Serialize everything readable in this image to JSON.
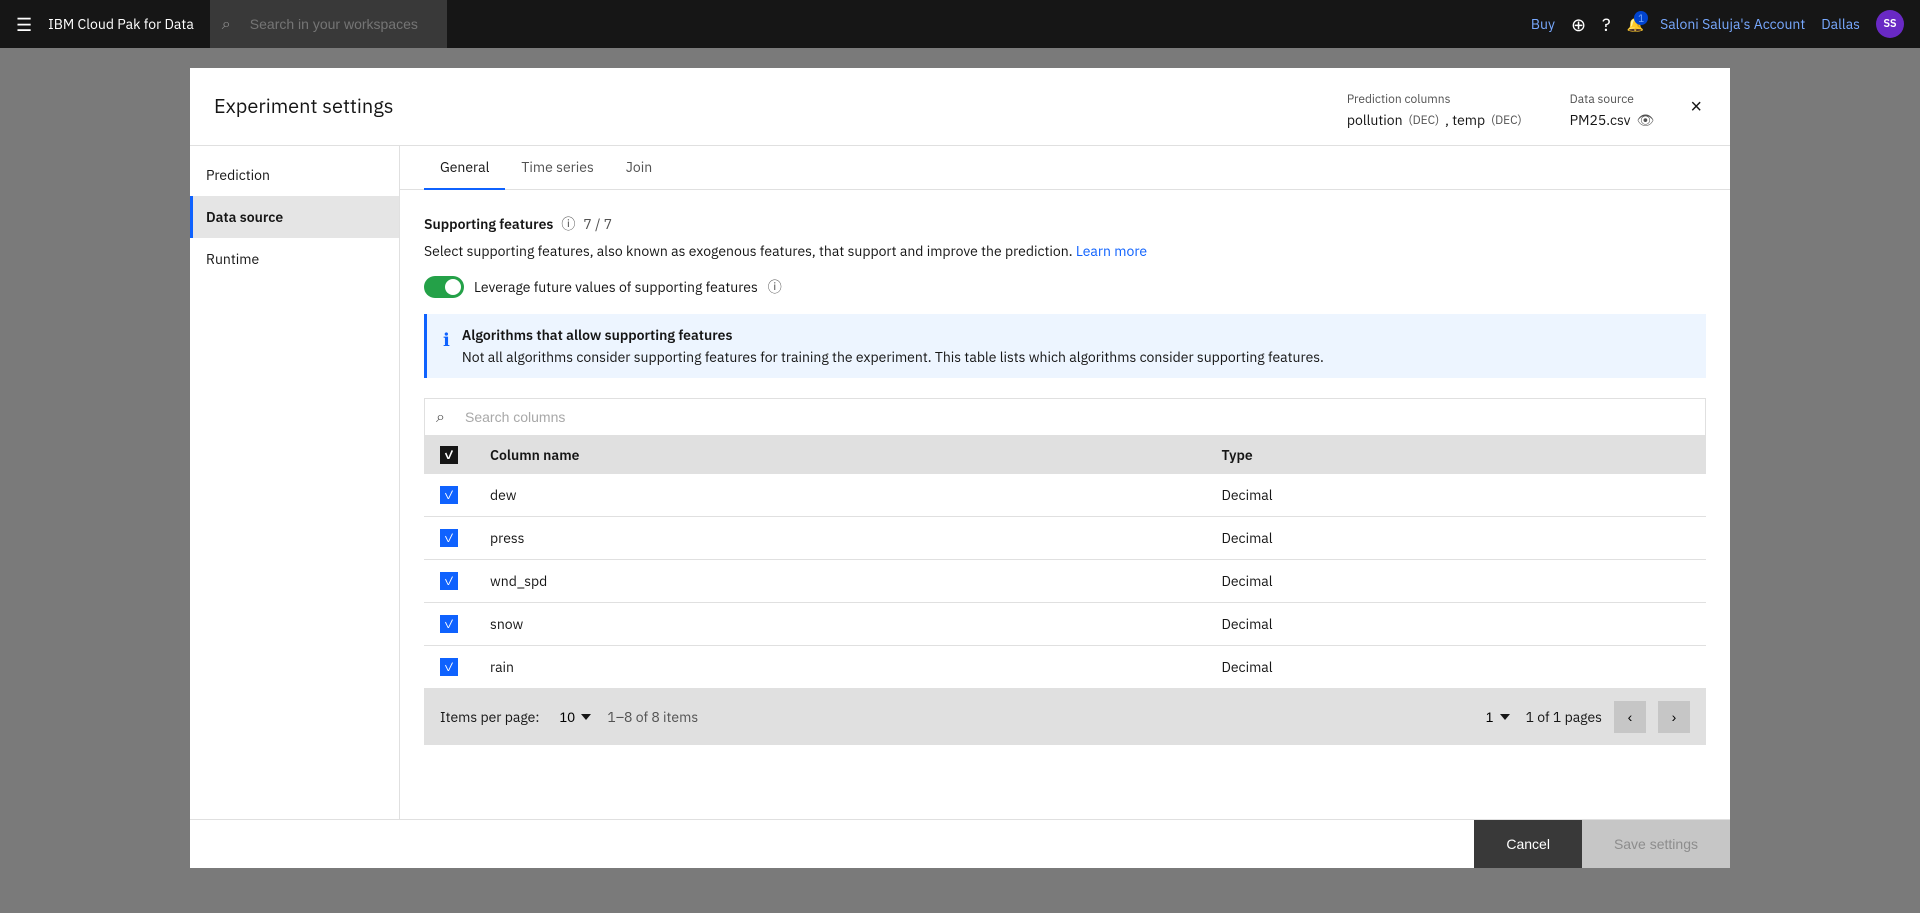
{
  "app": {
    "name": "IBM Cloud Pak for Data"
  },
  "topnav": {
    "search_placeholder": "Search in your workspaces",
    "buy_label": "Buy",
    "notification_count": "1",
    "user_name": "Saloni Saluja's Account",
    "region": "Dallas",
    "avatar_initials": "SS"
  },
  "modal": {
    "title": "Experiment settings",
    "close_label": "×",
    "prediction_columns_label": "Prediction columns",
    "prediction_columns_value": "pollution (DEC), temp (DEC)",
    "prediction_columns_plain": "pollution ",
    "prediction_columns_dec1": "(DEC)",
    "prediction_columns_sep": ", temp ",
    "prediction_columns_dec2": "(DEC)",
    "data_source_label": "Data source",
    "data_source_value": "PM25.csv"
  },
  "sidebar": {
    "items": [
      {
        "id": "prediction",
        "label": "Prediction",
        "active": false
      },
      {
        "id": "data-source",
        "label": "Data source",
        "active": true
      },
      {
        "id": "runtime",
        "label": "Runtime",
        "active": false
      }
    ]
  },
  "tabs": [
    {
      "id": "general",
      "label": "General",
      "active": true
    },
    {
      "id": "time-series",
      "label": "Time series",
      "active": false
    },
    {
      "id": "join",
      "label": "Join",
      "active": false
    }
  ],
  "supporting_features": {
    "title": "Supporting features",
    "count": "7 / 7",
    "description": "Select supporting features, also known as exogenous features, that support and improve the prediction.",
    "learn_more": "Learn more",
    "toggle_label": "Leverage future values of supporting features",
    "info_icon": "ⓘ"
  },
  "info_box": {
    "title": "Algorithms that allow supporting features",
    "description": "Not all algorithms consider supporting features for training the experiment. This table lists which algorithms consider supporting features."
  },
  "search": {
    "placeholder": "Search columns"
  },
  "table": {
    "headers": [
      {
        "id": "select",
        "label": ""
      },
      {
        "id": "column-name",
        "label": "Column name"
      },
      {
        "id": "type",
        "label": "Type"
      }
    ],
    "rows": [
      {
        "id": 1,
        "column_name": "dew",
        "type": "Decimal",
        "checked": true
      },
      {
        "id": 2,
        "column_name": "press",
        "type": "Decimal",
        "checked": true
      },
      {
        "id": 3,
        "column_name": "wnd_spd",
        "type": "Decimal",
        "checked": true
      },
      {
        "id": 4,
        "column_name": "snow",
        "type": "Decimal",
        "checked": true
      },
      {
        "id": 5,
        "column_name": "rain",
        "type": "Decimal",
        "checked": true
      }
    ]
  },
  "pagination": {
    "items_per_page_label": "Items per page:",
    "items_per_page_value": "10",
    "range": "1–8 of 8 items",
    "page": "1",
    "total_pages": "1 of 1 pages",
    "prev_icon": "‹",
    "next_icon": "›"
  },
  "footer": {
    "cancel_label": "Cancel",
    "save_label": "Save settings"
  }
}
